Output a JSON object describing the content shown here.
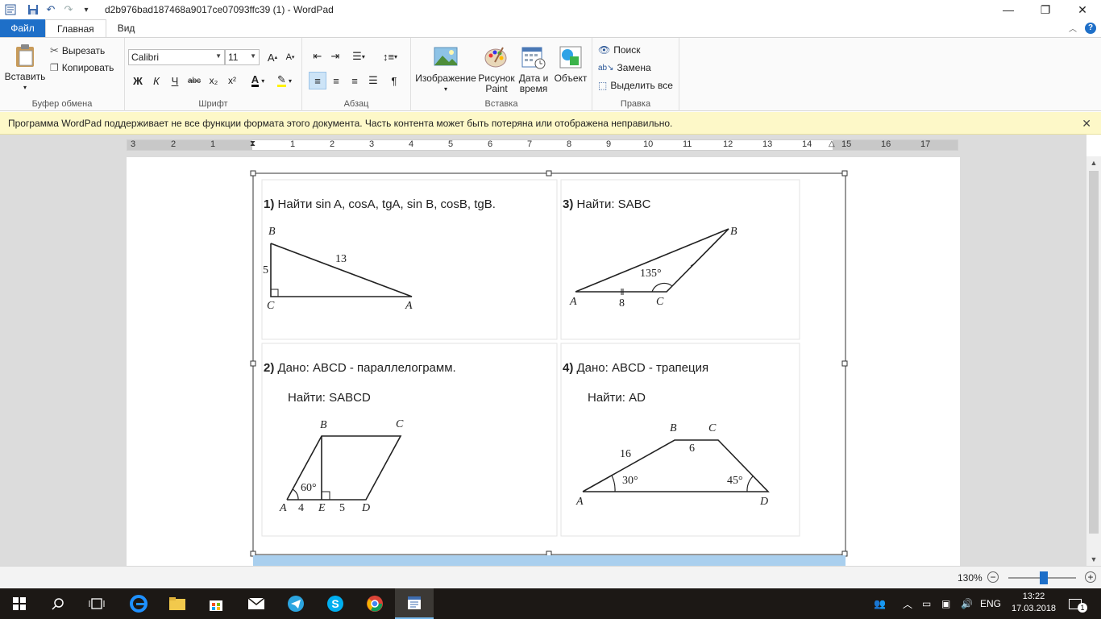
{
  "window": {
    "title": "d2b976bad187468a9017ce07093ffc39 (1) - WordPad"
  },
  "tabs": {
    "file": "Файл",
    "home": "Главная",
    "view": "Вид"
  },
  "ribbon": {
    "clipboard": {
      "label": "Буфер обмена",
      "paste": "Вставить",
      "cut": "Вырезать",
      "copy": "Копировать"
    },
    "font": {
      "label": "Шрифт",
      "family": "Calibri",
      "size": "11",
      "bold": "Ж",
      "italic": "К",
      "underline": "Ч",
      "strike": "abc"
    },
    "paragraph": {
      "label": "Абзац"
    },
    "insert": {
      "label": "Вставка",
      "image": "Изображение",
      "paint_line1": "Рисунок",
      "paint_line2": "Paint",
      "datetime_line1": "Дата и",
      "datetime_line2": "время",
      "object": "Объект"
    },
    "editing": {
      "label": "Правка",
      "find": "Поиск",
      "replace": "Замена",
      "select_all": "Выделить все"
    }
  },
  "notice": {
    "text": "Программа WordPad поддерживает не все функции формата этого документа. Часть контента может быть потеряна или отображена неправильно."
  },
  "ruler": {
    "left_ticks": [
      "3",
      "2",
      "1"
    ],
    "right_ticks": [
      "1",
      "2",
      "3",
      "4",
      "5",
      "6",
      "7",
      "8",
      "9",
      "10",
      "11",
      "12",
      "13",
      "14",
      "15",
      "16",
      "17"
    ]
  },
  "document": {
    "task1": {
      "num": "1)",
      "text": "Найти sin A, cosA, tgA, sin B, cosB, tgB.",
      "labels": {
        "B": "B",
        "C": "C",
        "A": "A",
        "leg": "5",
        "hyp": "13"
      }
    },
    "task3": {
      "num": "3)",
      "text": "Найти: SABC",
      "labels": {
        "A": "A",
        "C": "C",
        "B": "B",
        "side": "8",
        "angle": "135°"
      }
    },
    "task2": {
      "num": "2)",
      "text": "Дано: ABCD -  параллелограмм.",
      "find": "Найти: SABCD",
      "labels": {
        "A": "A",
        "B": "B",
        "C": "C",
        "D": "D",
        "E": "E",
        "ae": "4",
        "ed": "5",
        "angle": "60°"
      }
    },
    "task4": {
      "num": "4)",
      "text": "Дано: ABCD - трапеция",
      "find": "Найти: AD",
      "labels": {
        "A": "A",
        "B": "B",
        "C": "C",
        "D": "D",
        "ab": "16",
        "bc": "6",
        "angleA": "30°",
        "angleD": "45°"
      }
    }
  },
  "status": {
    "zoom": "130%"
  },
  "taskbar": {
    "lang": "ENG",
    "time": "13:22",
    "date": "17.03.2018",
    "notifications": "1"
  }
}
